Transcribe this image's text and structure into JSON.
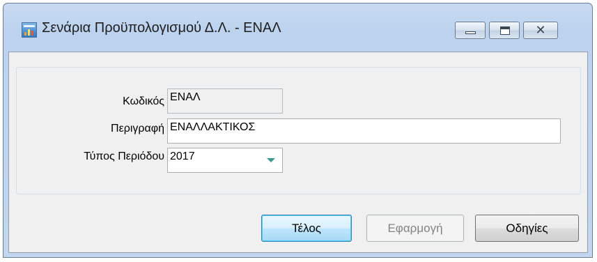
{
  "window": {
    "title": "Σενάρια Προϋπολογισμού Δ.Λ. - ΕΝΑΛ",
    "icon": "app-chart-icon",
    "caption_buttons": [
      "minimize-icon",
      "maximize-icon",
      "close-icon"
    ],
    "close_glyph": "✕"
  },
  "form": {
    "code": {
      "label": "Κωδικός",
      "value": "ΕΝΑΛ"
    },
    "description": {
      "label": "Περιγραφή",
      "value": "ΕΝΑΛΛΑΚΤΙΚΟΣ"
    },
    "period_type": {
      "label": "Τύπος Περιόδου",
      "value": "2017"
    }
  },
  "buttons": {
    "ok": "Τέλος",
    "apply": "Εφαρμογή",
    "help": "Οδηγίες"
  },
  "colors": {
    "titlebar": "#bcd2ee",
    "client": "#f0f0f0",
    "default_button": "#bee6fd",
    "dropdown_arrow": "#3a9a8f"
  }
}
